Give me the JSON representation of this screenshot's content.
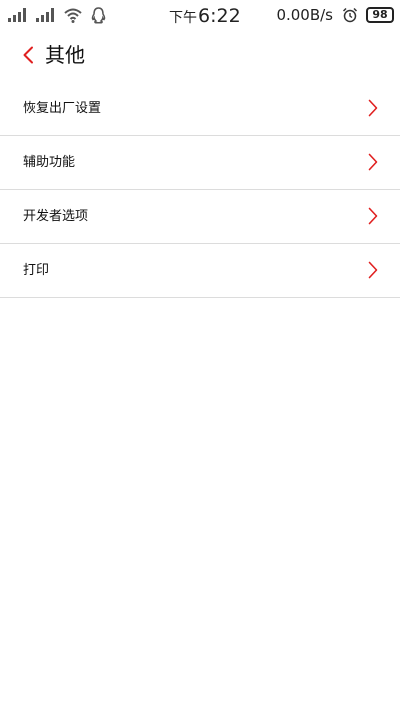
{
  "status_bar": {
    "ampm": "下午",
    "time": "6:22",
    "net_speed": "0.00B/s",
    "battery": "98",
    "icons": [
      "signal-icon",
      "signal-icon",
      "wifi-icon",
      "qq-icon",
      "alarm-icon",
      "battery-icon"
    ]
  },
  "header": {
    "title": "其他"
  },
  "items": [
    {
      "label": "恢复出厂设置"
    },
    {
      "label": "辅助功能"
    },
    {
      "label": "开发者选项"
    },
    {
      "label": "打印"
    }
  ],
  "colors": {
    "accent": "#e02020",
    "divider": "#dcdcdc",
    "text": "#111111",
    "status_icon": "#555555"
  }
}
